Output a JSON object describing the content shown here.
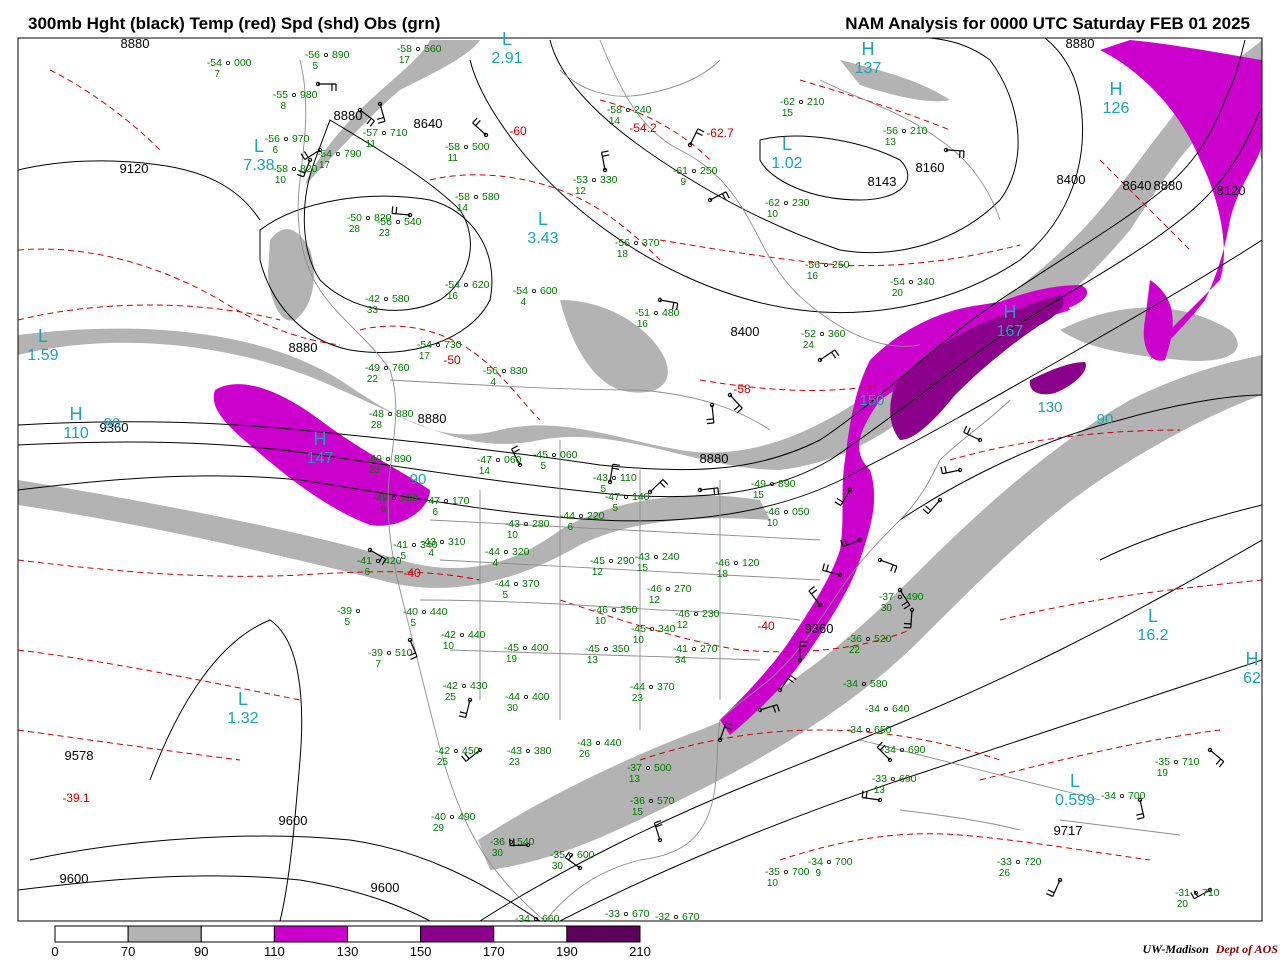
{
  "header": {
    "title_left": "300mb Hght (black) Temp (red) Spd (shd) Obs (grn)",
    "title_right": "NAM Analysis for 0000 UTC Saturday  FEB 01 2025"
  },
  "colors": {
    "height_contour": "#000000",
    "temperature_contour": "#cc0000",
    "observation": "#007700",
    "centers": "#1aa3b8",
    "coastline": "#8c8c8c",
    "speed_70_90": "#b3b3b3",
    "speed_110_130": "#cc00cc",
    "speed_150_170": "#8b008b",
    "speed_190_210": "#5c005c"
  },
  "legend": {
    "ticks": [
      "0",
      "70",
      "90",
      "110",
      "130",
      "150",
      "170",
      "190",
      "210"
    ]
  },
  "height_labels": [
    "8880",
    "8880",
    "8640",
    "9120",
    "8880",
    "9360",
    "8400",
    "8143",
    "8160",
    "8400",
    "8640",
    "8880",
    "8120",
    "9360",
    "8880",
    "8880",
    "9578",
    "9600",
    "9600",
    "9600",
    "9717",
    "8880"
  ],
  "temp_labels": [
    "-60",
    "-54.2",
    "-62.7",
    "-50",
    "-40",
    "-58",
    "-39.1",
    "-40"
  ],
  "centers": [
    {
      "letter": "L",
      "value": "7.38"
    },
    {
      "letter": "L",
      "value": "2.91"
    },
    {
      "letter": "L",
      "value": "3.43"
    },
    {
      "letter": "L",
      "value": "1.02"
    },
    {
      "letter": "L",
      "value": "1.59"
    },
    {
      "letter": "H",
      "value": "110"
    },
    {
      "letter": "H",
      "value": "147"
    },
    {
      "letter": "H",
      "value": "137"
    },
    {
      "letter": "H",
      "value": "126"
    },
    {
      "letter": "H",
      "value": "167"
    },
    {
      "letter": "L",
      "value": "16.2"
    },
    {
      "letter": "L",
      "value": "1.32"
    },
    {
      "letter": "L",
      "value": "0.599"
    },
    {
      "letter": "H",
      "value": "62"
    }
  ],
  "speed_labels": [
    "90",
    "90",
    "130",
    "90",
    "150"
  ],
  "observations": [
    {
      "t": "-54",
      "h": "000",
      "s": "7"
    },
    {
      "t": "-56",
      "h": "890",
      "s": "5"
    },
    {
      "t": "-58",
      "h": "560",
      "s": "17"
    },
    {
      "t": "-55",
      "h": "980",
      "s": "8"
    },
    {
      "t": "-57",
      "h": "710",
      "s": "11"
    },
    {
      "t": "-56",
      "h": "970",
      "s": "6"
    },
    {
      "t": "-54",
      "h": "790",
      "s": "17"
    },
    {
      "t": "-58",
      "h": "820",
      "s": "10"
    },
    {
      "t": "-58",
      "h": "500",
      "s": "11"
    },
    {
      "t": "-58",
      "h": "240",
      "s": "14"
    },
    {
      "t": "-62",
      "h": "210",
      "s": "15"
    },
    {
      "t": "-56",
      "h": "210",
      "s": "13"
    },
    {
      "t": "-61",
      "h": "250",
      "s": "9"
    },
    {
      "t": "-53",
      "h": "330",
      "s": "12"
    },
    {
      "t": "-58",
      "h": "580",
      "s": "14"
    },
    {
      "t": "-62",
      "h": "230",
      "s": "10"
    },
    {
      "t": "-56",
      "h": "540",
      "s": "23"
    },
    {
      "t": "-50",
      "h": "820",
      "s": "28"
    },
    {
      "t": "-56",
      "h": "370",
      "s": "18"
    },
    {
      "t": "-56",
      "h": "250",
      "s": "16"
    },
    {
      "t": "-54",
      "h": "340",
      "s": "20"
    },
    {
      "t": "-54",
      "h": "620",
      "s": "16"
    },
    {
      "t": "-54",
      "h": "600",
      "s": "4"
    },
    {
      "t": "-42",
      "h": "580",
      "s": "33"
    },
    {
      "t": "-51",
      "h": "480",
      "s": "16"
    },
    {
      "t": "-52",
      "h": "360",
      "s": "24"
    },
    {
      "t": "-54",
      "h": "730",
      "s": "17"
    },
    {
      "t": "-49",
      "h": "760",
      "s": "22"
    },
    {
      "t": "-56",
      "h": "830",
      "s": "4"
    },
    {
      "t": "-48",
      "h": "880",
      "s": "28"
    },
    {
      "t": "-47",
      "h": "060",
      "s": "14"
    },
    {
      "t": "-45",
      "h": "060",
      "s": "5"
    },
    {
      "t": "-49",
      "h": "890",
      "s": "23"
    },
    {
      "t": "-49",
      "h": "120",
      "s": "6"
    },
    {
      "t": "-47",
      "h": "170",
      "s": "6"
    },
    {
      "t": "-41",
      "h": "340",
      "s": "5"
    },
    {
      "t": "-43",
      "h": "310",
      "s": "4"
    },
    {
      "t": "-43",
      "h": "280",
      "s": "10"
    },
    {
      "t": "-44",
      "h": "220",
      "s": "6"
    },
    {
      "t": "-47",
      "h": "140",
      "s": "5"
    },
    {
      "t": "-43",
      "h": "110",
      "s": "5"
    },
    {
      "t": "-44",
      "h": "320",
      "s": "4"
    },
    {
      "t": "-45",
      "h": "290",
      "s": "12"
    },
    {
      "t": "-43",
      "h": "240",
      "s": "15"
    },
    {
      "t": "-46",
      "h": "270",
      "s": "12"
    },
    {
      "t": "-46",
      "h": "050",
      "s": "10"
    },
    {
      "t": "-49",
      "h": "890",
      "s": "15"
    },
    {
      "t": "-41",
      "h": "420",
      "s": "6"
    },
    {
      "t": "-44",
      "h": "370",
      "s": "5"
    },
    {
      "t": "-39",
      "h": "",
      "s": "5"
    },
    {
      "t": "-40",
      "h": "440",
      "s": "5"
    },
    {
      "t": "-42",
      "h": "440",
      "s": "10"
    },
    {
      "t": "-46",
      "h": "350",
      "s": "10"
    },
    {
      "t": "-46",
      "h": "230",
      "s": "12"
    },
    {
      "t": "-46",
      "h": "120",
      "s": "18"
    },
    {
      "t": "-45",
      "h": "340",
      "s": "10"
    },
    {
      "t": "-39",
      "h": "510",
      "s": "7"
    },
    {
      "t": "-45",
      "h": "400",
      "s": "19"
    },
    {
      "t": "-45",
      "h": "350",
      "s": "13"
    },
    {
      "t": "-41",
      "h": "270",
      "s": "34"
    },
    {
      "t": "-42",
      "h": "430",
      "s": "25"
    },
    {
      "t": "-44",
      "h": "400",
      "s": "30"
    },
    {
      "t": "-44",
      "h": "370",
      "s": "23"
    },
    {
      "t": "-42",
      "h": "450",
      "s": "25"
    },
    {
      "t": "-43",
      "h": "380",
      "s": "23"
    },
    {
      "t": "-43",
      "h": "440",
      "s": "26"
    },
    {
      "t": "-37",
      "h": "500",
      "s": "13"
    },
    {
      "t": "-36",
      "h": "570",
      "s": "15"
    },
    {
      "t": "-40",
      "h": "490",
      "s": "29"
    },
    {
      "t": "-36",
      "h": "540",
      "s": "30"
    },
    {
      "t": "-35",
      "h": "600",
      "s": "30"
    },
    {
      "t": "-36",
      "h": "520",
      "s": "22"
    },
    {
      "t": "-37",
      "h": "490",
      "s": "30"
    },
    {
      "t": "-34",
      "h": "580",
      "s": ""
    },
    {
      "t": "-34",
      "h": "640",
      "s": ""
    },
    {
      "t": "-34",
      "h": "650",
      "s": ""
    },
    {
      "t": "-34",
      "h": "690",
      "s": ""
    },
    {
      "t": "-33",
      "h": "690",
      "s": "13"
    },
    {
      "t": "-35",
      "h": "710",
      "s": "19"
    },
    {
      "t": "-34",
      "h": "700",
      "s": ""
    },
    {
      "t": "-35",
      "h": "700",
      "s": "10"
    },
    {
      "t": "-34",
      "h": "700",
      "s": "9"
    },
    {
      "t": "-33",
      "h": "720",
      "s": "26"
    },
    {
      "t": "-31",
      "h": "710",
      "s": "20"
    },
    {
      "t": "-34",
      "h": "660",
      "s": ""
    },
    {
      "t": "-33",
      "h": "670",
      "s": ""
    },
    {
      "t": "-32",
      "h": "670",
      "s": ""
    }
  ],
  "credit": {
    "org": "UW-Madison",
    "dept": "Dept of AOS"
  }
}
